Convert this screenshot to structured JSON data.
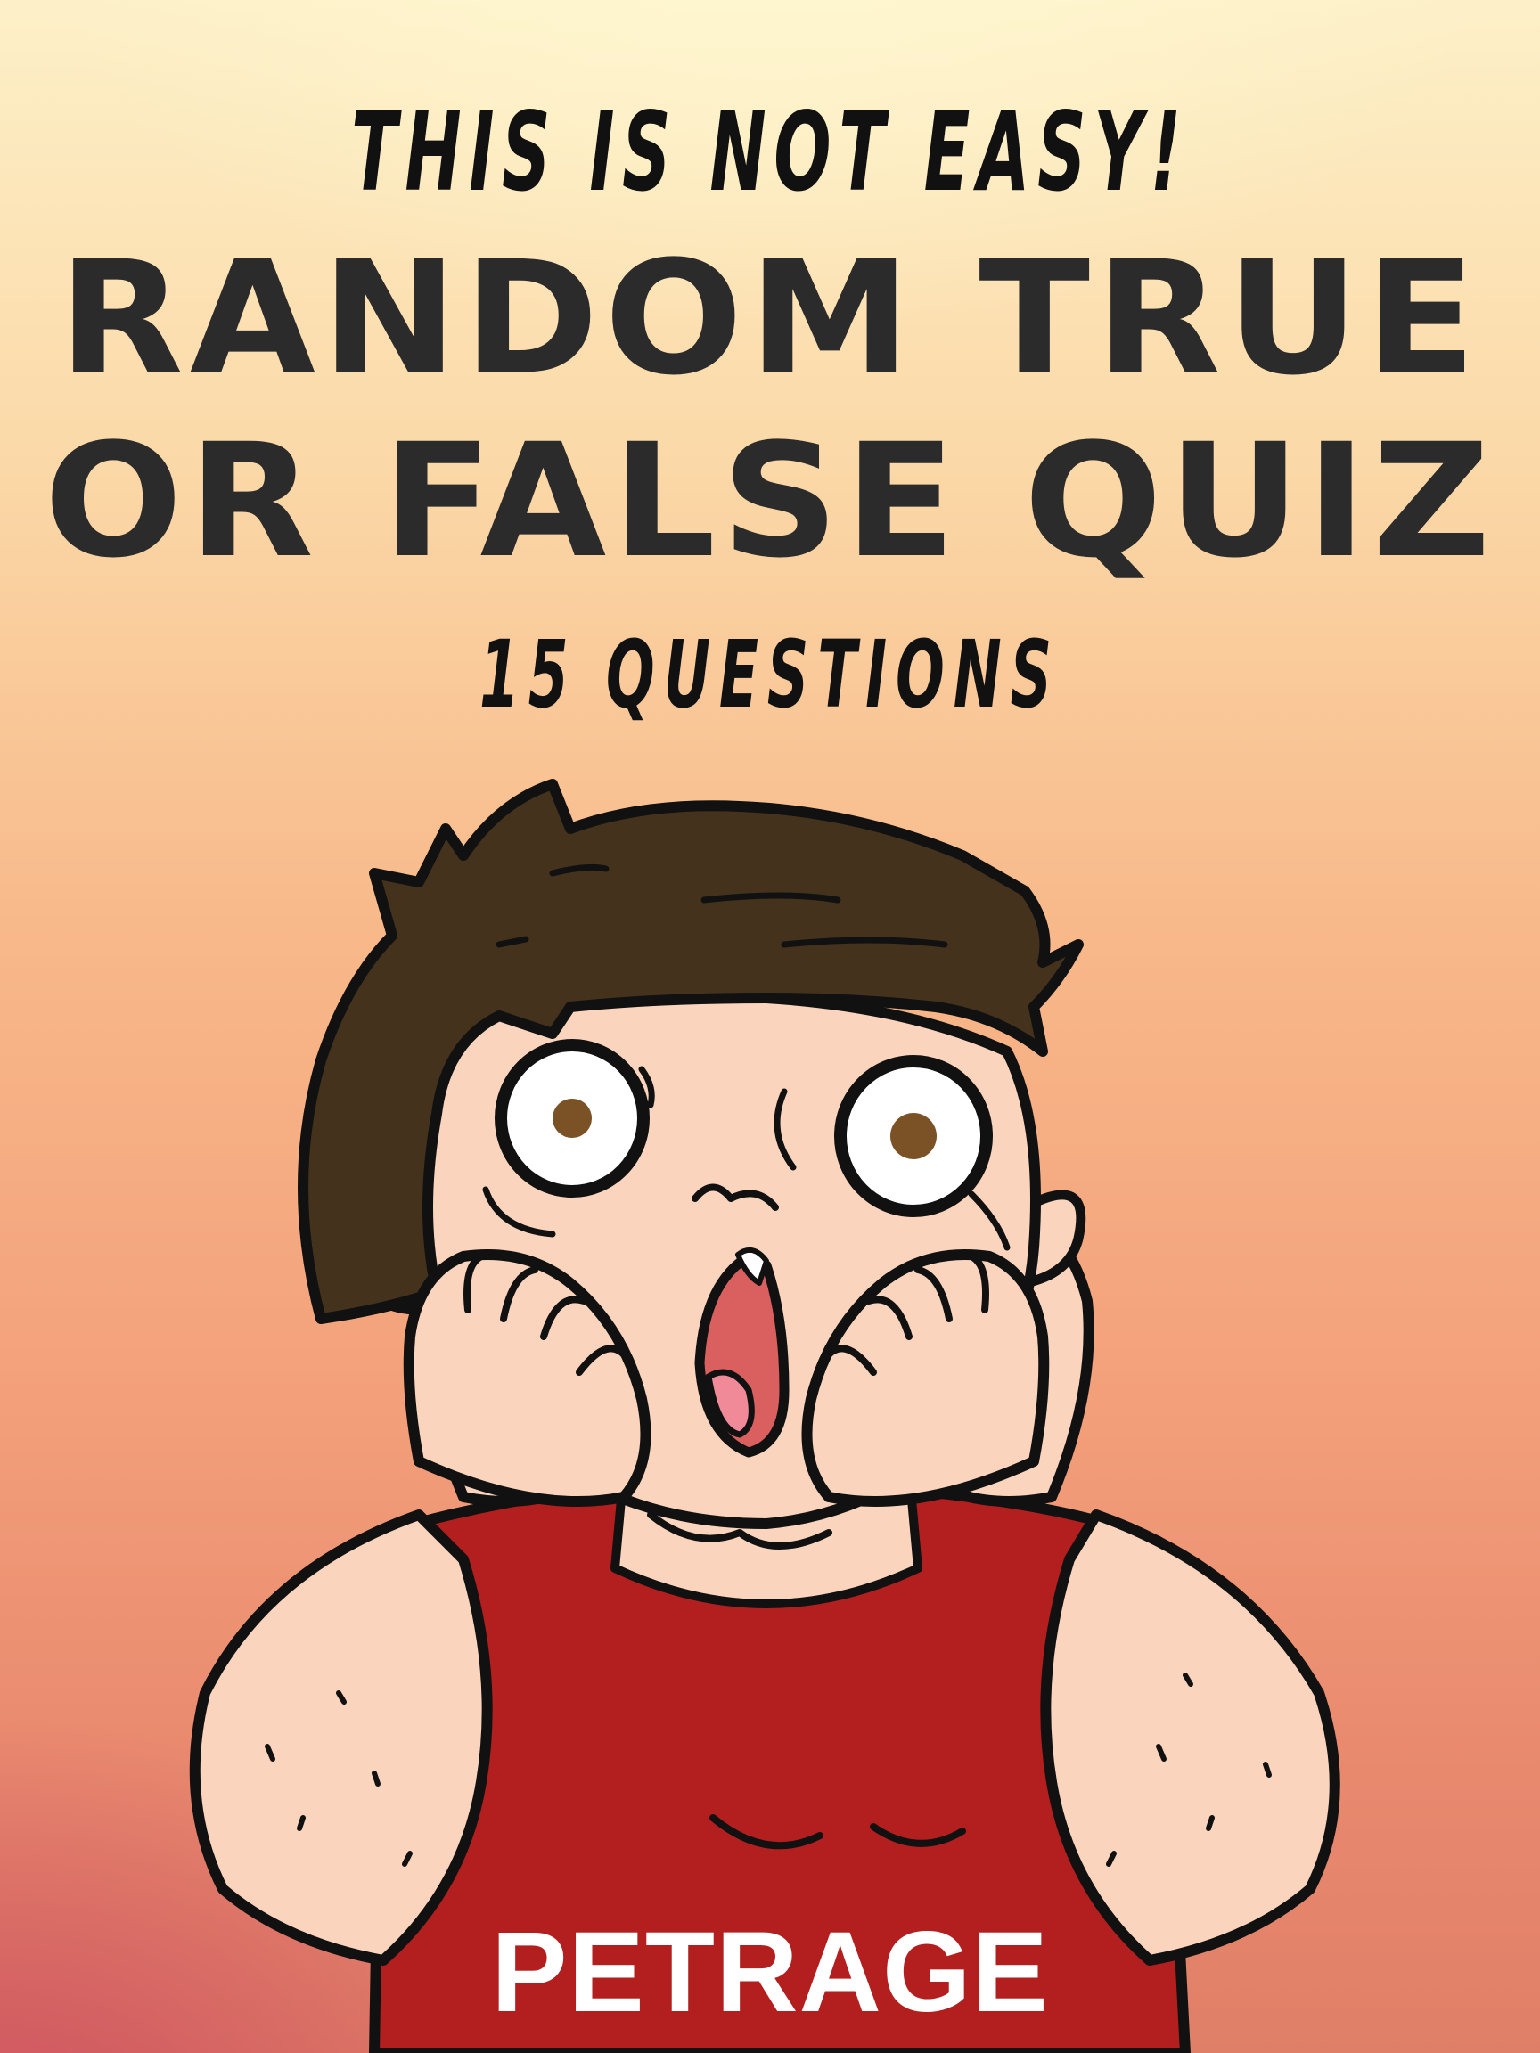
{
  "cover": {
    "tagline": "THIS IS NOT EASY!",
    "title_line_1": "RANDOM TRUE",
    "title_line_2": "OR FALSE QUIZ",
    "subtitle": "15 QUESTIONS",
    "author": "PETRAGE"
  },
  "illustration": {
    "subject": "shocked-cartoon-man",
    "colors": {
      "hair": "#44321c",
      "skin": "#fad4bc",
      "shirt": "#b31e1e",
      "outline": "#111111",
      "iris": "#7a5225",
      "mouth": "#d9605e",
      "tongue": "#f08a99"
    }
  }
}
